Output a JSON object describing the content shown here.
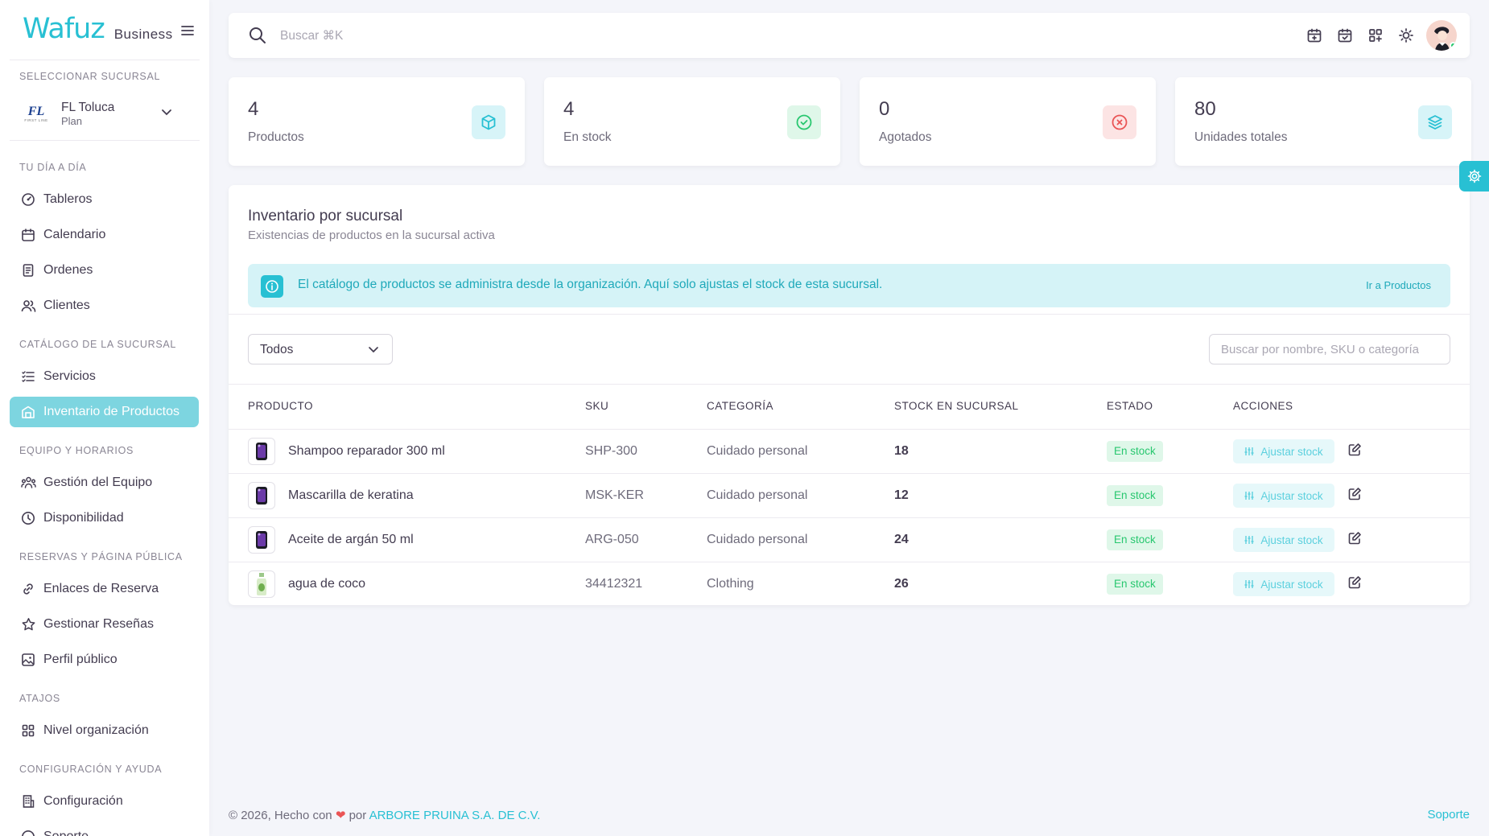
{
  "brand": {
    "logo": "Wafuz",
    "suffix": "Business"
  },
  "sidebar": {
    "branch_section": "Seleccionar sucursal",
    "branch": {
      "logo_text": "FL",
      "logo_sub": "FIRST LINE",
      "name": "FL Toluca",
      "plan": "Plan"
    },
    "sections": [
      {
        "title": "Tu día a día"
      },
      {
        "title": "Catálogo de la sucursal"
      },
      {
        "title": "Equipo y horarios"
      },
      {
        "title": "Reservas y página pública"
      },
      {
        "title": "Atajos"
      },
      {
        "title": "Configuración y ayuda"
      }
    ],
    "items": [
      {
        "label": "Tableros",
        "icon": "dashboard-icon"
      },
      {
        "label": "Calendario",
        "icon": "calendar-icon"
      },
      {
        "label": "Ordenes",
        "icon": "receipt-icon"
      },
      {
        "label": "Clientes",
        "icon": "users-icon"
      },
      {
        "label": "Servicios",
        "icon": "list-icon"
      },
      {
        "label": "Inventario de Productos",
        "icon": "building-store-icon",
        "active": true
      },
      {
        "label": "Gestión del Equipo",
        "icon": "team-icon"
      },
      {
        "label": "Disponibilidad",
        "icon": "clock-icon"
      },
      {
        "label": "Enlaces de Reserva",
        "icon": "link-icon"
      },
      {
        "label": "Gestionar Reseñas",
        "icon": "star-icon"
      },
      {
        "label": "Perfil público",
        "icon": "photo-icon"
      },
      {
        "label": "Nivel organización",
        "icon": "grid-icon"
      },
      {
        "label": "Configuración",
        "icon": "building-icon"
      },
      {
        "label": "Soporte",
        "icon": "help-icon"
      }
    ]
  },
  "topbar": {
    "search_placeholder": "Buscar ⌘K"
  },
  "stats": [
    {
      "value": "4",
      "label": "Productos",
      "icon": "cube-icon",
      "color": "#28c0d3"
    },
    {
      "value": "4",
      "label": "En stock",
      "icon": "check-circle-icon",
      "color": "#28c76f"
    },
    {
      "value": "0",
      "label": "Agotados",
      "icon": "x-circle-icon",
      "color": "#ea5455"
    },
    {
      "value": "80",
      "label": "Unidades totales",
      "icon": "layers-icon",
      "color": "#28c0d3"
    }
  ],
  "inventory": {
    "title": "Inventario por sucursal",
    "subtitle": "Existencias de productos en la sucursal activa",
    "alert_text": "El catálogo de productos se administra desde la organización. Aquí solo ajustas el stock de esta sucursal.",
    "alert_link": "Ir a Productos",
    "filter_value": "Todos",
    "search_placeholder": "Buscar por nombre, SKU o categoría",
    "columns": [
      "Producto",
      "SKU",
      "Categoría",
      "Stock en sucursal",
      "Estado",
      "Acciones"
    ],
    "rows": [
      {
        "name": "Shampoo reparador 300 ml",
        "sku": "SHP-300",
        "category": "Cuidado personal",
        "stock": "18",
        "status": "En stock",
        "action": "Ajustar stock"
      },
      {
        "name": "Mascarilla de keratina",
        "sku": "MSK-KER",
        "category": "Cuidado personal",
        "stock": "12",
        "status": "En stock",
        "action": "Ajustar stock"
      },
      {
        "name": "Aceite de argán 50 ml",
        "sku": "ARG-050",
        "category": "Cuidado personal",
        "stock": "24",
        "status": "En stock",
        "action": "Ajustar stock"
      },
      {
        "name": "agua de coco",
        "sku": "34412321",
        "category": "Clothing",
        "stock": "26",
        "status": "En stock",
        "action": "Ajustar stock"
      }
    ]
  },
  "footer": {
    "prefix": "© 2026, Hecho con",
    "by": "por",
    "company": "ARBORE PRUINA S.A. DE C.V.",
    "support": "Soporte"
  }
}
